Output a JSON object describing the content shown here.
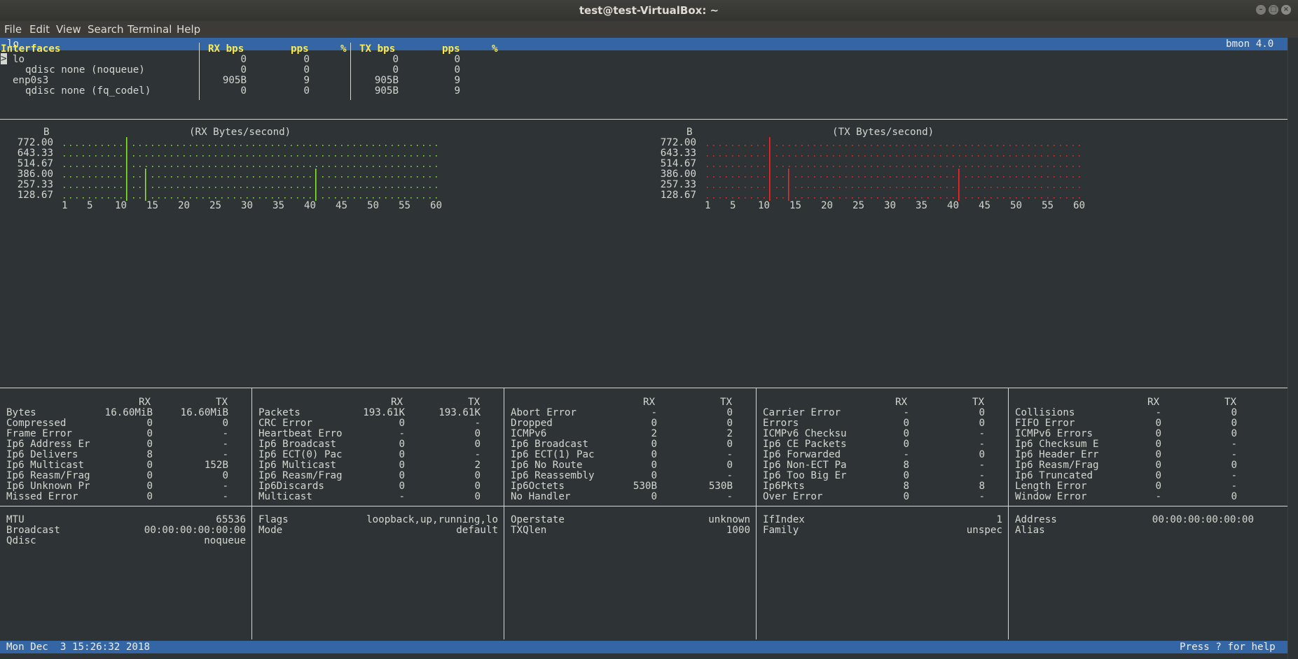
{
  "window": {
    "title": "test@test-VirtualBox: ~"
  },
  "menu": [
    "File",
    "Edit",
    "View",
    "Search",
    "Terminal",
    "Help"
  ],
  "header": {
    "interface": "lo",
    "app": "bmon 4.0"
  },
  "iface_table": {
    "headers": {
      "interfaces": "Interfaces",
      "rx_bps": "RX bps",
      "rx_pps": "pps",
      "rx_pct": "%",
      "tx_bps": "TX bps",
      "tx_pps": "pps",
      "tx_pct": "%"
    },
    "cursor": ">",
    "rows": [
      {
        "name": "lo",
        "rx_bps": "0",
        "rx_pps": "0",
        "tx_bps": "0",
        "tx_pps": "0"
      },
      {
        "name": "qdisc none (noqueue)",
        "rx_bps": "0",
        "rx_pps": "0",
        "tx_bps": "0",
        "tx_pps": "0"
      },
      {
        "name": "enp0s3",
        "rx_bps": "905B",
        "rx_pps": "9",
        "tx_bps": "905B",
        "tx_pps": "9"
      },
      {
        "name": "qdisc none (fq_codel)",
        "rx_bps": "0",
        "rx_pps": "0",
        "tx_bps": "905B",
        "tx_pps": "9"
      }
    ]
  },
  "graphs": {
    "unit": "B",
    "rx_title": "(RX Bytes/second)",
    "tx_title": "(TX Bytes/second)",
    "y_labels": [
      "772.00",
      "643.33",
      "514.67",
      "386.00",
      "257.33",
      "128.67"
    ],
    "x_labels": [
      "1",
      "5",
      "10",
      "15",
      "20",
      "25",
      "30",
      "35",
      "40",
      "45",
      "50",
      "55",
      "60"
    ],
    "rx_color": "#8ae234",
    "tx_color": "#ef2929"
  },
  "details": {
    "col_rx": "RX",
    "col_tx": "TX",
    "columns": [
      [
        {
          "label": "Bytes",
          "rx": "16.60MiB",
          "tx": "16.60MiB"
        },
        {
          "label": "Compressed",
          "rx": "0",
          "tx": "0"
        },
        {
          "label": "Frame Error",
          "rx": "0",
          "tx": "-"
        },
        {
          "label": "Ip6 Address Er",
          "rx": "0",
          "tx": "-"
        },
        {
          "label": "Ip6 Delivers",
          "rx": "8",
          "tx": "-"
        },
        {
          "label": "Ip6 Multicast",
          "rx": "0",
          "tx": "152B"
        },
        {
          "label": "Ip6 Reasm/Frag",
          "rx": "0",
          "tx": "0"
        },
        {
          "label": "Ip6 Unknown Pr",
          "rx": "0",
          "tx": "-"
        },
        {
          "label": "Missed Error",
          "rx": "0",
          "tx": "-"
        }
      ],
      [
        {
          "label": "Packets",
          "rx": "193.61K",
          "tx": "193.61K"
        },
        {
          "label": "CRC Error",
          "rx": "0",
          "tx": "-"
        },
        {
          "label": "Heartbeat Erro",
          "rx": "-",
          "tx": "0"
        },
        {
          "label": "Ip6 Broadcast",
          "rx": "0",
          "tx": "0"
        },
        {
          "label": "Ip6 ECT(0) Pac",
          "rx": "0",
          "tx": "-"
        },
        {
          "label": "Ip6 Multicast",
          "rx": "0",
          "tx": "2"
        },
        {
          "label": "Ip6 Reasm/Frag",
          "rx": "0",
          "tx": "0"
        },
        {
          "label": "Ip6Discards",
          "rx": "0",
          "tx": "0"
        },
        {
          "label": "Multicast",
          "rx": "-",
          "tx": "0"
        }
      ],
      [
        {
          "label": "Abort Error",
          "rx": "-",
          "tx": "0"
        },
        {
          "label": "Dropped",
          "rx": "0",
          "tx": "0"
        },
        {
          "label": "ICMPv6",
          "rx": "2",
          "tx": "2"
        },
        {
          "label": "Ip6 Broadcast",
          "rx": "0",
          "tx": "0"
        },
        {
          "label": "Ip6 ECT(1) Pac",
          "rx": "0",
          "tx": "-"
        },
        {
          "label": "Ip6 No Route",
          "rx": "0",
          "tx": "0"
        },
        {
          "label": "Ip6 Reassembly",
          "rx": "0",
          "tx": "-"
        },
        {
          "label": "Ip6Octets",
          "rx": "530B",
          "tx": "530B"
        },
        {
          "label": "No Handler",
          "rx": "0",
          "tx": "-"
        }
      ],
      [
        {
          "label": "Carrier Error",
          "rx": "-",
          "tx": "0"
        },
        {
          "label": "Errors",
          "rx": "0",
          "tx": "0"
        },
        {
          "label": "ICMPv6 Checksu",
          "rx": "0",
          "tx": "-"
        },
        {
          "label": "Ip6 CE Packets",
          "rx": "0",
          "tx": "-"
        },
        {
          "label": "Ip6 Forwarded",
          "rx": "-",
          "tx": "0"
        },
        {
          "label": "Ip6 Non-ECT Pa",
          "rx": "8",
          "tx": "-"
        },
        {
          "label": "Ip6 Too Big Er",
          "rx": "0",
          "tx": "-"
        },
        {
          "label": "Ip6Pkts",
          "rx": "8",
          "tx": "8"
        },
        {
          "label": "Over Error",
          "rx": "0",
          "tx": "-"
        }
      ],
      [
        {
          "label": "Collisions",
          "rx": "-",
          "tx": "0"
        },
        {
          "label": "FIFO Error",
          "rx": "0",
          "tx": "0"
        },
        {
          "label": "ICMPv6 Errors",
          "rx": "0",
          "tx": "0"
        },
        {
          "label": "Ip6 Checksum E",
          "rx": "0",
          "tx": "-"
        },
        {
          "label": "Ip6 Header Err",
          "rx": "0",
          "tx": "-"
        },
        {
          "label": "Ip6 Reasm/Frag",
          "rx": "0",
          "tx": "0"
        },
        {
          "label": "Ip6 Truncated",
          "rx": "0",
          "tx": "-"
        },
        {
          "label": "Length Error",
          "rx": "0",
          "tx": "-"
        },
        {
          "label": "Window Error",
          "rx": "-",
          "tx": "0"
        }
      ]
    ]
  },
  "info": [
    [
      {
        "label": "MTU",
        "value": "65536"
      },
      {
        "label": "Broadcast",
        "value": "00:00:00:00:00:00"
      },
      {
        "label": "Qdisc",
        "value": "noqueue"
      }
    ],
    [
      {
        "label": "Flags",
        "value": "loopback,up,running,lo"
      },
      {
        "label": "Mode",
        "value": "default"
      }
    ],
    [
      {
        "label": "Operstate",
        "value": "unknown"
      },
      {
        "label": "TXQlen",
        "value": "1000"
      }
    ],
    [
      {
        "label": "IfIndex",
        "value": "1"
      },
      {
        "label": "Family",
        "value": "unspec"
      }
    ],
    [
      {
        "label": "Address",
        "value": "00:00:00:00:00:00"
      },
      {
        "label": "Alias",
        "value": ""
      }
    ]
  ],
  "status": {
    "datetime": "Mon Dec  3 15:26:32 2018",
    "help": "Press ? for help"
  }
}
